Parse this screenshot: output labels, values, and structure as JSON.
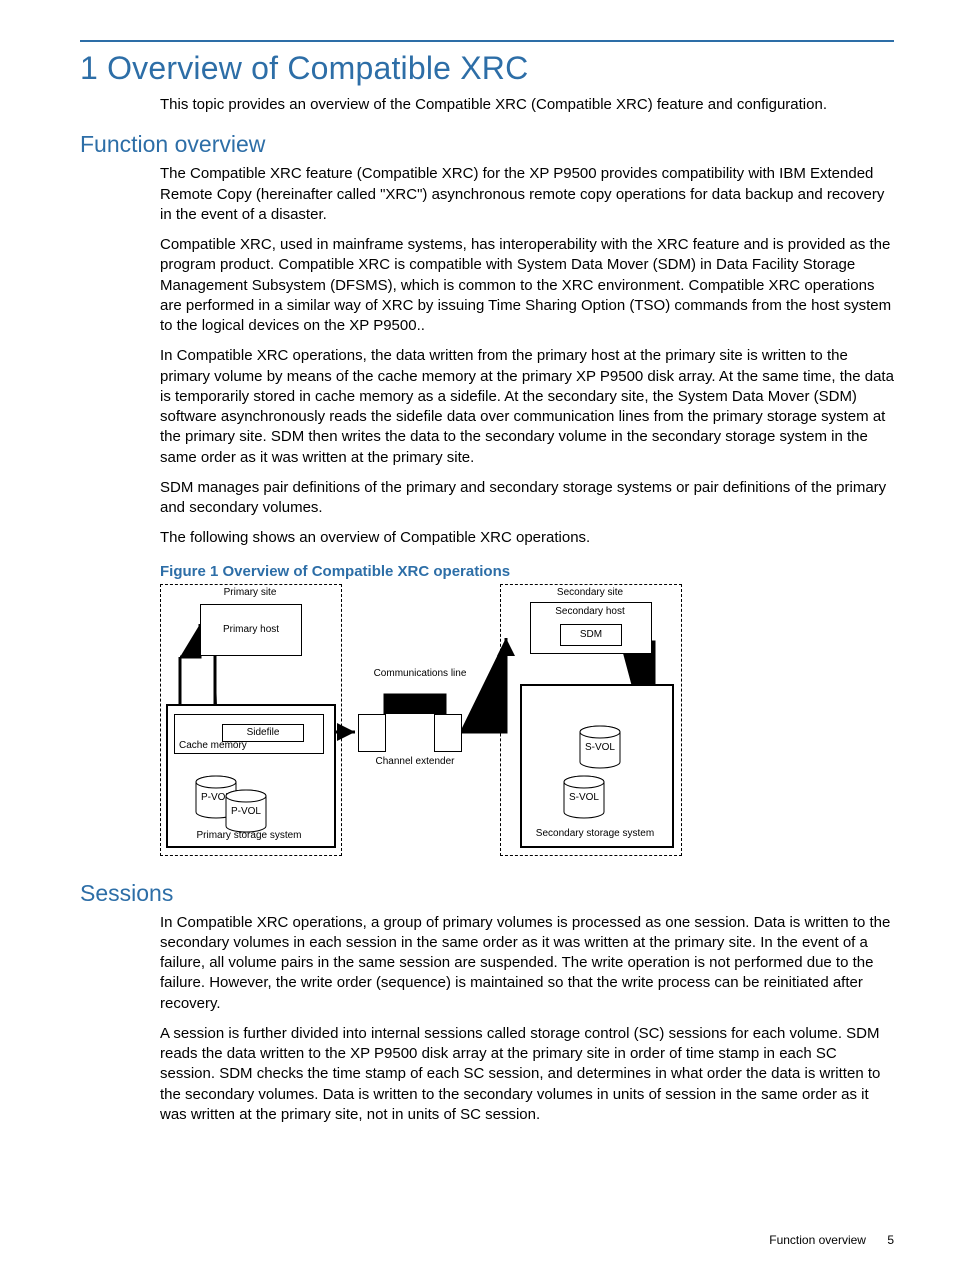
{
  "heading": "1 Overview of Compatible XRC",
  "intro": "This topic provides an overview of the Compatible XRC (Compatible XRC) feature and configuration.",
  "section1_title": "Function overview",
  "s1_p1": "The Compatible XRC feature (Compatible XRC) for the XP P9500 provides compatibility with IBM Extended Remote Copy (hereinafter called \"XRC\") asynchronous remote copy operations for data backup and recovery in the event of a disaster.",
  "s1_p2": "Compatible XRC, used in mainframe systems, has interoperability with the XRC feature and is provided as the program product. Compatible XRC is compatible with System Data Mover (SDM) in Data Facility Storage Management Subsystem (DFSMS), which is common to the XRC environment. Compatible XRC operations are performed in a similar way of XRC by issuing Time Sharing Option (TSO) commands from the host system to the logical devices on the XP P9500..",
  "s1_p3": "In Compatible XRC operations, the data written from the primary host at the primary site is written to the primary volume by means of the cache memory at the primary XP P9500 disk array. At the same time, the data is temporarily stored in cache memory as a sidefile. At the secondary site, the System Data Mover (SDM) software asynchronously reads the sidefile data over communication lines from the primary storage system at the primary site. SDM then writes the data to the secondary volume in the secondary storage system in the same order as it was written at the primary site.",
  "s1_p4": "SDM manages pair definitions of the primary and secondary storage systems or pair definitions of the primary and secondary volumes.",
  "s1_p5": "The following shows an overview of Compatible XRC operations.",
  "figure_caption": "Figure 1 Overview of Compatible XRC operations",
  "fig": {
    "primary_site": "Primary site",
    "primary_host": "Primary host",
    "communications_line": "Communications line",
    "sidefile": "Sidefile",
    "cache_memory": "Cache memory",
    "channel_extender": "Channel extender",
    "pvol": "P-VOL",
    "primary_storage": "Primary storage system",
    "secondary_site": "Secondary site",
    "secondary_host": "Secondary host",
    "sdm": "SDM",
    "svol": "S-VOL",
    "secondary_storage": "Secondary storage system"
  },
  "section2_title": "Sessions",
  "s2_p1": "In Compatible XRC operations, a group of primary volumes is processed as one session. Data is written to the secondary volumes in each session in the same order as it was written at the primary site. In the event of a failure, all volume pairs in the same session are suspended. The write operation is not performed due to the failure. However, the write order (sequence) is maintained so that the write process can be reinitiated after recovery.",
  "s2_p2": "A session is further divided into internal sessions called storage control (SC) sessions for each volume. SDM reads the data written to the XP P9500 disk array at the primary site in order of time stamp in each SC session. SDM checks the time stamp of each SC session, and determines in what order the data is written to the secondary volumes. Data is written to the secondary volumes in units of session in the same order as it was written at the primary site, not in units of SC session.",
  "footer_text": "Function overview",
  "page_number": "5"
}
